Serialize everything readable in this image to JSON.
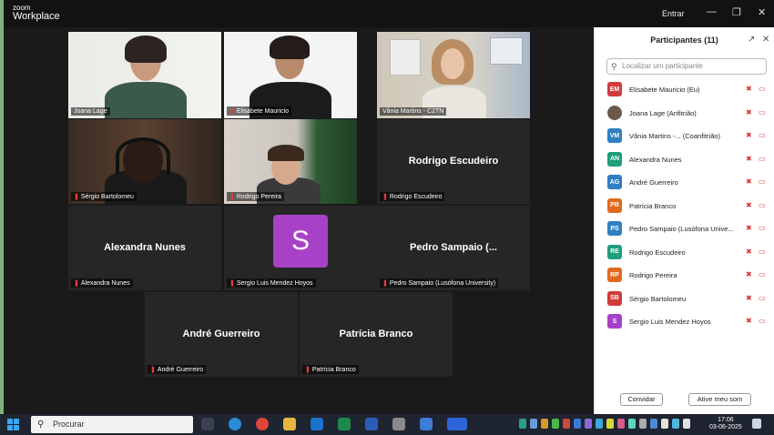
{
  "titlebar": {
    "logo_line1": "zoom",
    "logo_line2": "Workplace",
    "entrar": "Entrar",
    "min_icon": "minimize-icon",
    "max_icon": "maximize-icon",
    "close_icon": "close-icon"
  },
  "tiles": {
    "t1": "Joana Lage",
    "t2": "Elisabete Mauricio",
    "t3": "Vânia Martins - C2TN",
    "t4": "Sérgio Bartolomeu",
    "t5": "Rodrigo Pereira",
    "t6_big": "Rodrigo Escudeiro",
    "t6": "Rodrigo Escudeiro",
    "t7_big": "Alexandra Nunes",
    "t7": "Alexandra Nunes",
    "t8_letter": "S",
    "t8": "Sergio Luis Mendez Hoyos",
    "t9_big": "Pedro Sampaio (...",
    "t9": "Pedro Sampaio (Lusófona University)",
    "t10_big": "André Guerreiro",
    "t10": "André Guerreiro",
    "t11_big": "Patrícia Branco",
    "t11": "Patrícia Branco"
  },
  "panel": {
    "title": "Participantes (11)",
    "search_placeholder": "Localizar um participante",
    "participants": [
      {
        "initials": "EM",
        "name": "Elisabete Mauricio (Eu)",
        "color": "#d13b3b"
      },
      {
        "initials": "",
        "name": "Joana Lage (Anfitrião)",
        "color": "#6b5a4a"
      },
      {
        "initials": "VM",
        "name": "Vânia Martins -...  (Coanfitrião)",
        "color": "#2f7fc1"
      },
      {
        "initials": "AN",
        "name": "Alexandra Nunes",
        "color": "#1e9e7a"
      },
      {
        "initials": "AG",
        "name": "André Guerreiro",
        "color": "#2f7fc1"
      },
      {
        "initials": "PB",
        "name": "Patrícia Branco",
        "color": "#e06a1f"
      },
      {
        "initials": "PS",
        "name": "Pedro Sampaio (Lusófona Unive...",
        "color": "#2f7fc1"
      },
      {
        "initials": "RE",
        "name": "Rodrigo Escudeiro",
        "color": "#1e9e7a"
      },
      {
        "initials": "RP",
        "name": "Rodrigo Pereira",
        "color": "#e06a1f"
      },
      {
        "initials": "SB",
        "name": "Sérgio Bartolomeu",
        "color": "#d13b3b"
      },
      {
        "initials": "S",
        "name": "Sergio Luis Mendez Hoyos",
        "color": "#a741c8"
      }
    ],
    "convidar": "Convidar",
    "ative_som": "Ative meu som"
  },
  "taskbar": {
    "search_label": "Procurar",
    "time": "17:06",
    "date": "03-06-2025"
  }
}
